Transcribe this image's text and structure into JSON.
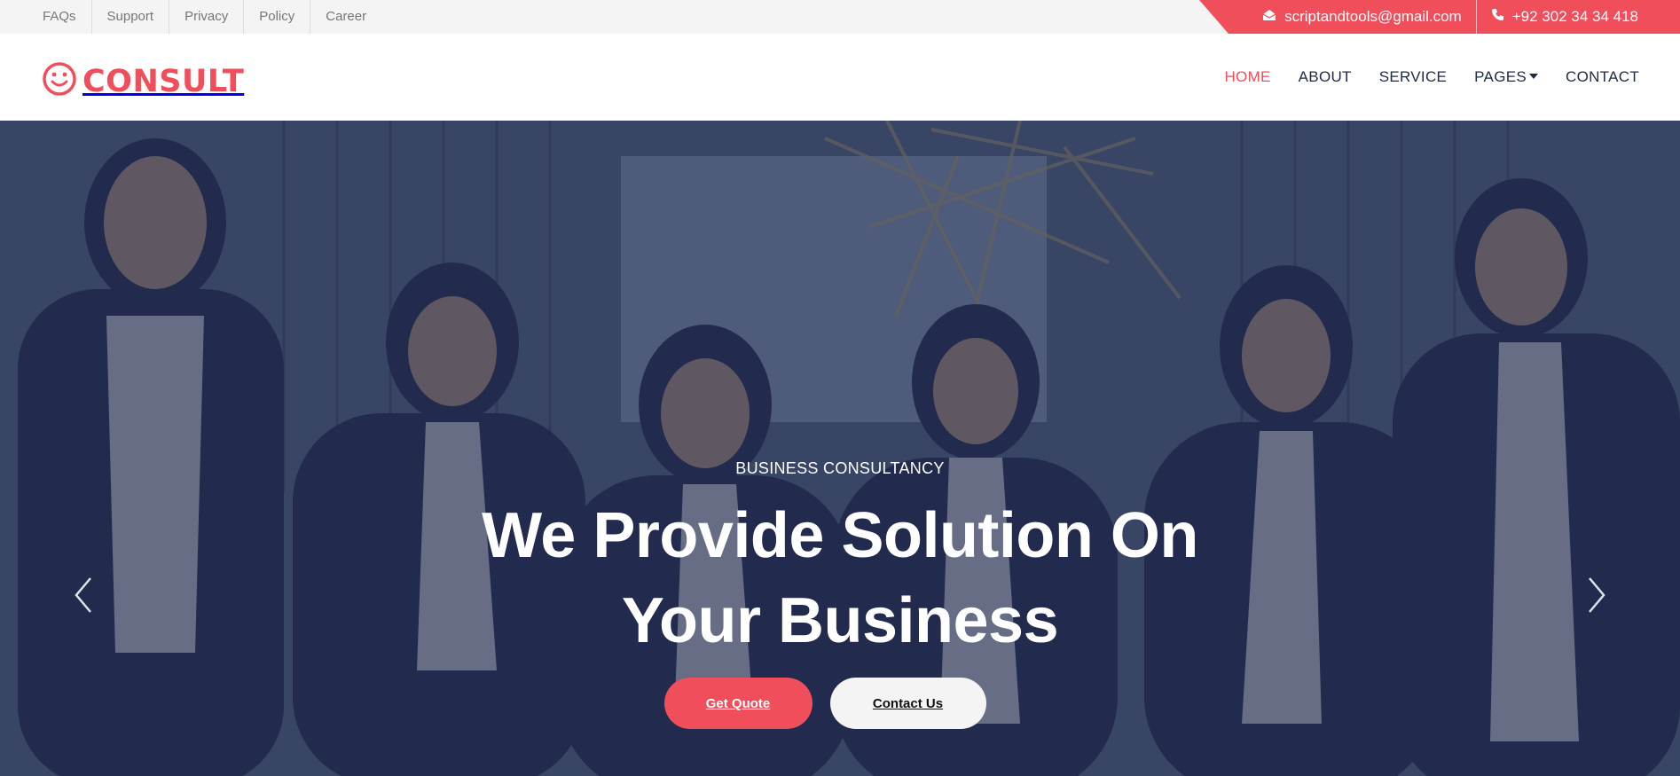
{
  "topbar": {
    "links": [
      "FAQs",
      "Support",
      "Privacy",
      "Policy",
      "Career"
    ],
    "email": "scriptandtools@gmail.com",
    "phone": "+92 302 34 34 418"
  },
  "brand": {
    "name": "CONSULT",
    "icon": "smiley-icon"
  },
  "nav": {
    "items": [
      {
        "label": "HOME",
        "active": true
      },
      {
        "label": "ABOUT"
      },
      {
        "label": "SERVICE"
      },
      {
        "label": "PAGES",
        "dropdown": true
      },
      {
        "label": "CONTACT"
      }
    ]
  },
  "hero": {
    "eyebrow": "BUSINESS CONSULTANCY",
    "headline_line1": "We Provide Solution On",
    "headline_line2": "Your Business",
    "primary_button": "Get Quote",
    "secondary_button": "Contact Us"
  },
  "colors": {
    "accent": "#f04e5b",
    "navy": "#1f2a44",
    "topbar_bg": "#f4f4f4"
  }
}
